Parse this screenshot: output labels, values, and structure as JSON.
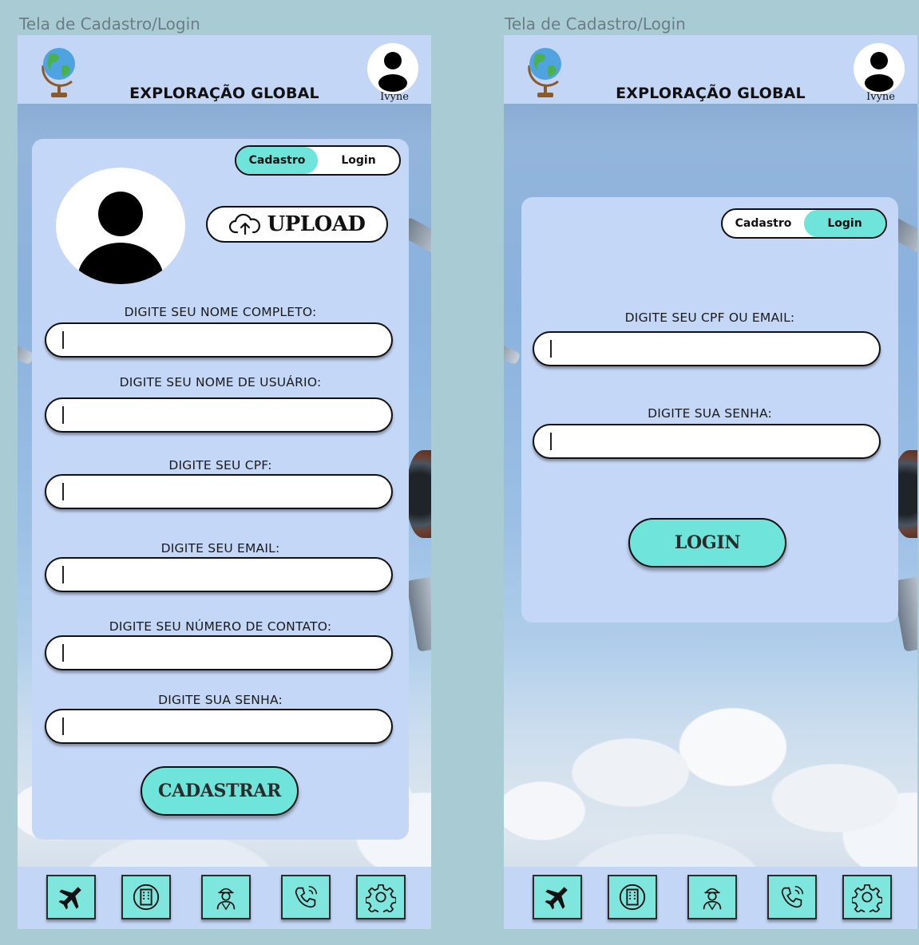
{
  "frames": [
    {
      "label": "Tela de Cadastro/Login",
      "header": {
        "title": "EXPLORAÇÃO GLOBAL",
        "user_name": "Ivyne"
      },
      "toggle": {
        "option1": "Cadastro",
        "option2": "Login",
        "active": "Cadastro"
      },
      "upload_label": "UPLOAD",
      "fields": [
        {
          "label": "DIGITE SEU NOME COMPLETO:",
          "value": "",
          "placeholder": ""
        },
        {
          "label": "DIGITE SEU NOME DE USUÁRIO:",
          "value": "",
          "placeholder": ""
        },
        {
          "label": "DIGITE SEU CPF:",
          "value": "",
          "placeholder": ""
        },
        {
          "label": "DIGITE SEU EMAIL:",
          "value": "",
          "placeholder": ""
        },
        {
          "label": "DIGITE SEU NÚMERO DE CONTATO:",
          "value": "",
          "placeholder": ""
        },
        {
          "label": "DIGITE SUA SENHA:",
          "value": "",
          "placeholder": ""
        }
      ],
      "submit_label": "CADASTRAR"
    },
    {
      "label": "Tela de Cadastro/Login",
      "header": {
        "title": "EXPLORAÇÃO GLOBAL",
        "user_name": "Ivyne"
      },
      "toggle": {
        "option1": "Cadastro",
        "option2": "Login",
        "active": "Login"
      },
      "fields": [
        {
          "label": "DIGITE SEU CPF OU EMAIL:",
          "value": "",
          "placeholder": ""
        },
        {
          "label": "DIGITE SUA SENHA:",
          "value": "",
          "placeholder": ""
        }
      ],
      "submit_label": "LOGIN"
    }
  ],
  "nav_items": [
    {
      "icon": "airplane-icon"
    },
    {
      "icon": "building-icon"
    },
    {
      "icon": "guide-person-icon"
    },
    {
      "icon": "phone-icon"
    },
    {
      "icon": "gear-icon"
    }
  ],
  "colors": {
    "page_bg": "#a9ccd4",
    "header_bg": "#c4d6f6",
    "card_bg": "#c5d7f7",
    "accent": "#6ee4da",
    "nav_button": "#7fe6dd"
  }
}
